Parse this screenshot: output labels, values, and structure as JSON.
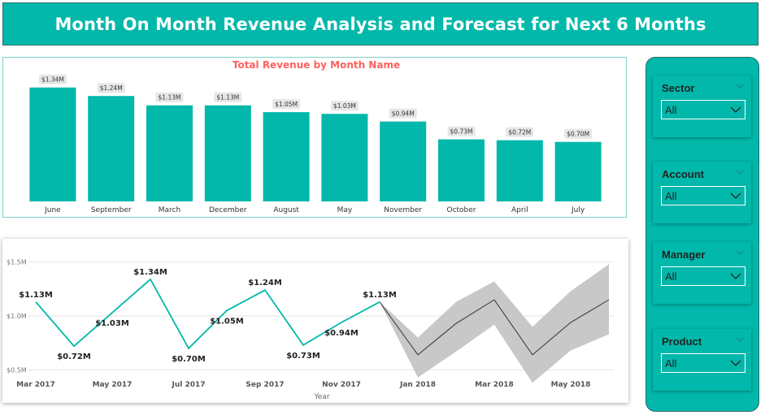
{
  "header": {
    "title": "Month On Month Revenue Analysis and Forecast for Next 6 Months"
  },
  "colors": {
    "accent": "#01b8aa",
    "title_red": "#fd625e",
    "forecast_band": "#c8c8c8",
    "forecast_line": "#333333"
  },
  "chart_data": [
    {
      "type": "bar",
      "title": "Total Revenue by Month Name",
      "categories": [
        "June",
        "September",
        "March",
        "December",
        "August",
        "May",
        "November",
        "October",
        "April",
        "July"
      ],
      "values": [
        1.34,
        1.24,
        1.13,
        1.13,
        1.05,
        1.03,
        0.94,
        0.73,
        0.72,
        0.7
      ],
      "data_labels": [
        "$1.34M",
        "$1.24M",
        "$1.13M",
        "$1.13M",
        "$1.05M",
        "$1.03M",
        "$0.94M",
        "$0.73M",
        "$0.72M",
        "$0.70M"
      ],
      "ylim": [
        0,
        1.5
      ],
      "grid": false
    },
    {
      "type": "line",
      "xlabel": "Year",
      "yticks": [
        "$0.5M",
        "$1.0M",
        "$1.5M"
      ],
      "ytick_values": [
        0.5,
        1.0,
        1.5
      ],
      "xticks": [
        "Mar 2017",
        "May 2017",
        "Jul 2017",
        "Sep 2017",
        "Nov 2017",
        "Jan 2018",
        "Mar 2018",
        "May 2018"
      ],
      "xtick_index": [
        0,
        2,
        4,
        6,
        8,
        10,
        12,
        14
      ],
      "ylim": [
        0.3,
        1.55
      ],
      "grid": true,
      "series": [
        {
          "values": [
            1.13,
            0.72,
            1.03,
            1.34,
            0.7,
            1.05,
            1.24,
            0.73,
            0.94,
            1.13
          ],
          "labels": [
            "$1.13M",
            "$0.72M",
            "$1.03M",
            "$1.34M",
            "$0.70M",
            "$1.05M",
            "$1.24M",
            "$0.73M",
            "$0.94M",
            "$1.13M"
          ]
        }
      ],
      "forecast": {
        "start_index": 9,
        "values": [
          1.13,
          0.64,
          0.93,
          1.15,
          0.64,
          0.94,
          1.15
        ],
        "upper": [
          1.13,
          0.8,
          1.13,
          1.32,
          0.9,
          1.23,
          1.48
        ],
        "lower": [
          1.13,
          0.43,
          0.67,
          0.92,
          0.38,
          0.68,
          0.83
        ]
      }
    }
  ],
  "slicers": [
    {
      "title": "Sector",
      "value": "All"
    },
    {
      "title": "Account",
      "value": "All"
    },
    {
      "title": "Manager",
      "value": "All"
    },
    {
      "title": "Product",
      "value": "All"
    }
  ]
}
